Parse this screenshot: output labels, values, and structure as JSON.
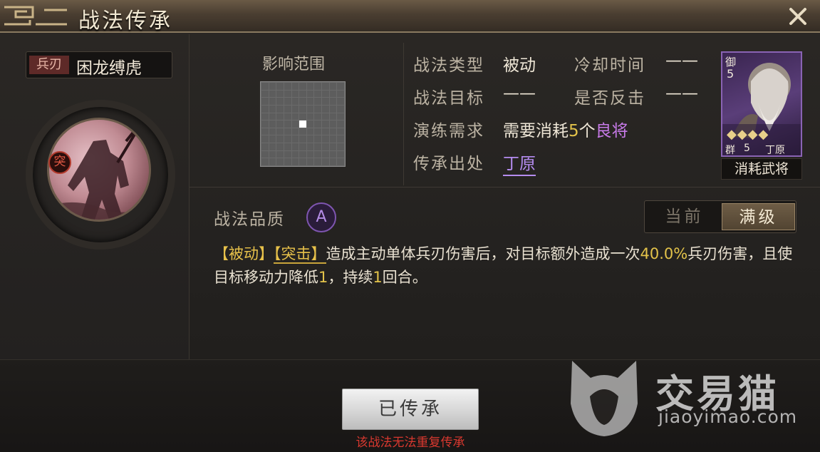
{
  "window": {
    "title": "战法传承"
  },
  "skill": {
    "type_tag": "兵刃",
    "name": "困龙缚虎",
    "badge": "突"
  },
  "range": {
    "label": "影响范围",
    "grid_size": 11
  },
  "info": {
    "type_label": "战法类型",
    "type_value": "被动",
    "cooldown_label": "冷却时间",
    "cooldown_value": "——",
    "target_label": "战法目标",
    "target_value": "——",
    "counter_label": "是否反击",
    "counter_value": "——",
    "require_label": "演练需求",
    "require_prefix": "需要消耗",
    "require_count": "5",
    "require_unit": "个",
    "require_quality": "良将",
    "source_label": "传承出处",
    "source_value": "丁原"
  },
  "card": {
    "side": "御",
    "cost": "5",
    "faction": "群",
    "level": "5",
    "name": "丁原",
    "stars": "◆◆◆◆",
    "caption": "消耗武将"
  },
  "quality": {
    "label": "战法品质",
    "grade": "A"
  },
  "toggle": {
    "current": "当前",
    "max": "满级"
  },
  "description": {
    "tag1": "【被动】",
    "tag2": "【突击】",
    "part1": "造成主动单体兵刃伤害后，对目标额外造成一次",
    "pct": "40.0%",
    "part2": "兵刃伤害，且使目标移动力降低",
    "num1": "1",
    "part3": "，持续",
    "num2": "1",
    "part4": "回合。"
  },
  "action": {
    "button": "已传承",
    "warning": "该战法无法重复传承"
  },
  "watermark": {
    "text": "交易猫",
    "url": "jiaoyimao.com"
  },
  "colors": {
    "accent_yellow": "#e3c34a",
    "accent_purple": "#c77ae8",
    "warning_red": "#d9382f"
  }
}
